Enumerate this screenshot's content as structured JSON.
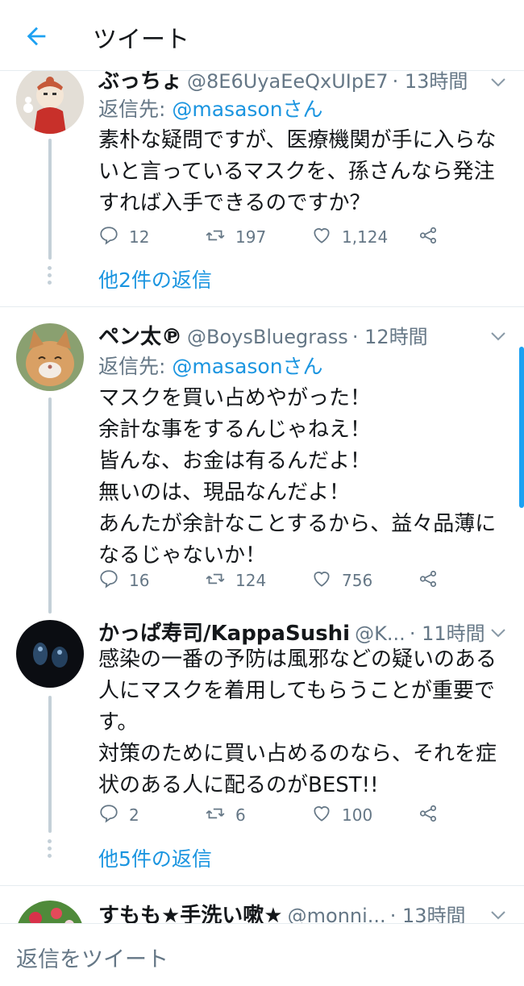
{
  "header": {
    "title": "ツイート"
  },
  "tweets": [
    {
      "name": "ぶっちょ",
      "handle": "@8E6UyaEeQxUIpE7",
      "time": "· 13時間",
      "reply_to_label": "返信先: ",
      "reply_to_mention": "@masasonさん",
      "lines": [
        "素朴な疑問ですが、医療機関が手に入らな",
        "いと言っているマスクを、孫さんなら発注",
        "すれば入手できるのですか？"
      ],
      "replies": "12",
      "retweets": "197",
      "likes": "1,124",
      "more_replies": "他2件の返信"
    },
    {
      "name": "ペン太℗",
      "handle": "@BoysBluegrass",
      "time": "· 12時間",
      "reply_to_label": "返信先: ",
      "reply_to_mention": "@masasonさん",
      "lines": [
        "マスクを買い占めやがった！",
        "余計な事をするんじゃねえ！",
        "皆んな、お金は有るんだよ！",
        "無いのは、現品なんだよ！",
        "あんたが余計なことするから、益々品薄に",
        "なるじゃないか！"
      ],
      "replies": "16",
      "retweets": "124",
      "likes": "756"
    },
    {
      "name": "かっぱ寿司/KappaSushi",
      "handle": "@K...",
      "time": "· 11時間",
      "lines": [
        "感染の一番の予防は風邪などの疑いのある",
        "人にマスクを着用してもらうことが重要で",
        "す。",
        "対策のために買い占めるのなら、それを症",
        "状のある人に配るのがBEST!!"
      ],
      "replies": "2",
      "retweets": "6",
      "likes": "100",
      "more_replies": "他5件の返信"
    },
    {
      "name": "すもも★手洗い嗽★",
      "handle": "@monni...",
      "time": "· 13時間"
    }
  ],
  "compose": {
    "placeholder": "返信をツイート"
  },
  "colors": {
    "accent": "#1da1f2",
    "link": "#1b95e0",
    "muted": "#657786"
  }
}
